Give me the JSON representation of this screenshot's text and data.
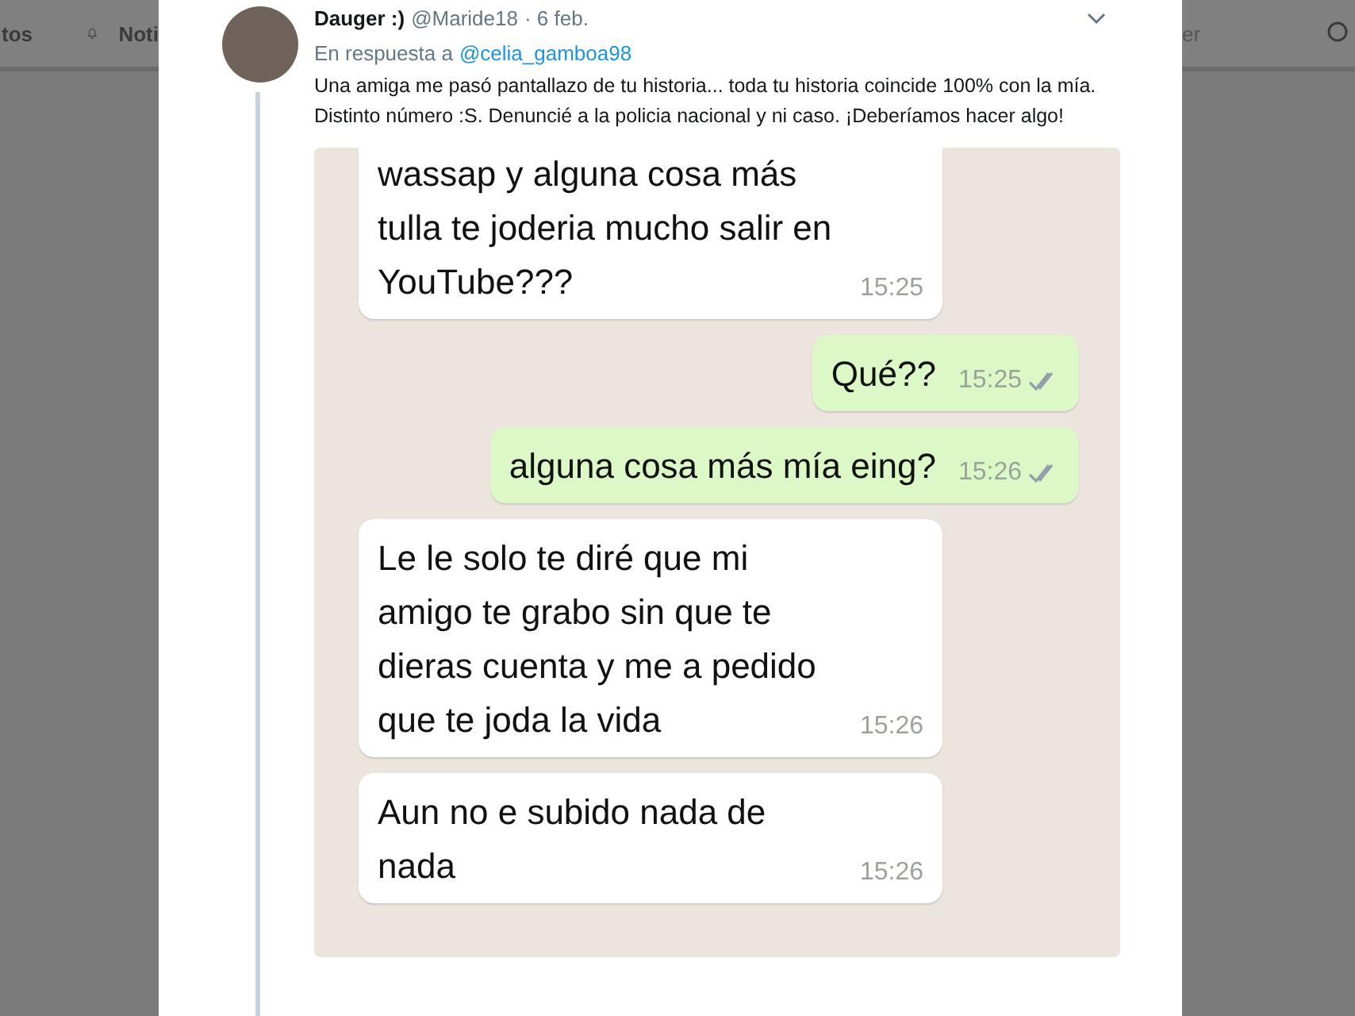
{
  "background_nav": {
    "left_item": "tos",
    "notifications": "Noti",
    "right_item": "er"
  },
  "tweet": {
    "name": "Dauger :)",
    "handle": "@Maride18",
    "date": "· 6 feb.",
    "reply_prefix": "En respuesta a",
    "reply_to": "@celia_gamboa98",
    "text": "Una amiga me pasó pantallazo de tu historia... toda tu historia coincide 100% con la mía. Distinto número :S. Denuncié a la policia nacional y ni caso. ¡Deberíamos hacer algo!"
  },
  "chat": {
    "messages": [
      {
        "kind": "in",
        "text": "wassap y alguna cosa más tulla te joderia mucho salir en YouTube???",
        "time": "15:25",
        "read": false
      },
      {
        "kind": "out",
        "text": "Qué??",
        "time": "15:25",
        "read": true
      },
      {
        "kind": "out",
        "text": "alguna cosa más mía eing?",
        "time": "15:26",
        "read": true
      },
      {
        "kind": "in",
        "text": "Le le solo te diré que mi amigo te grabo sin que te dieras cuenta y me a pedido que te joda la vida",
        "time": "15:26",
        "read": false
      },
      {
        "kind": "in",
        "text": "Aun no e subido nada de nada",
        "time": "15:26",
        "read": false
      }
    ]
  }
}
